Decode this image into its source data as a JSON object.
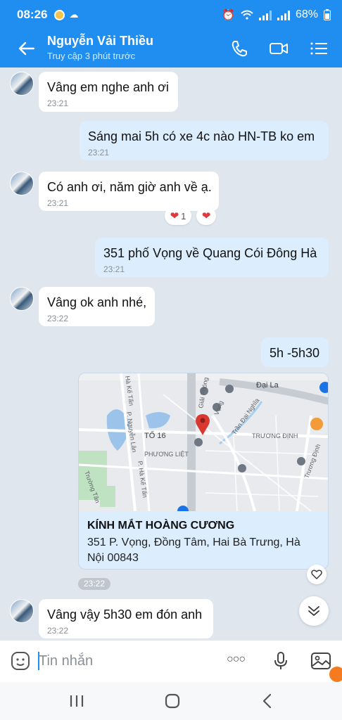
{
  "status_bar": {
    "time": "08:26",
    "battery": "68%"
  },
  "header": {
    "contact_name": "Nguyễn Vải Thiều",
    "last_seen": "Truy cập 3 phút trước",
    "icons": [
      "back-arrow-icon",
      "phone-icon",
      "video-call-icon",
      "menu-list-icon"
    ]
  },
  "messages": [
    {
      "direction": "in",
      "text": "Vâng em nghe anh ơi",
      "time": "23:21"
    },
    {
      "direction": "out",
      "text": "Sáng mai 5h có xe 4c nào HN-TB ko em",
      "time": "23:21"
    },
    {
      "direction": "in",
      "text": "Có anh ơi, năm giờ anh về ạ.",
      "time": "23:21",
      "reaction_count": "1"
    },
    {
      "direction": "out",
      "text": "351 phố Vọng về Quang Cói Đông Hà",
      "time": "23:21"
    },
    {
      "direction": "in",
      "text": "Vâng ok anh nhé,",
      "time": "23:22"
    },
    {
      "direction": "out",
      "text": "5h -5h30"
    },
    {
      "direction": "in",
      "text": "Vâng vậy 5h30 em đón anh",
      "time": "23:22"
    }
  ],
  "location_card": {
    "place_name": "KÍNH MẮT HOÀNG CƯƠNG",
    "address": "351 P. Vọng, Đồng Tâm, Hai Bà Trưng, Hà Nội 00843",
    "map_labels": {
      "dai_la": "Đại La",
      "to_16": "TỔ 16",
      "phuong_liet": "PHƯƠNG LIỆT",
      "truong_dinh_area": "TRƯƠNG ĐỊNH",
      "truong_dinh_street": "Trương Định",
      "giai_phong": "Giải Phóng",
      "vong": "Vọng",
      "tran_dai_nghia": "Trần Đại Nghĩa",
      "ha_ke_tan": "Hà Kế Tấn",
      "p_nguyen_lan": "P. Nguyễn Lân",
      "p_ha_ke_tan": "P. Hà Kế Tấn",
      "truong_tan": "Trường Tân"
    },
    "time": "23:22"
  },
  "composer": {
    "placeholder": "Tin nhắn",
    "more_dots": "○○○"
  },
  "colors": {
    "brand_blue": "#1f8ef0",
    "outgoing_bubble": "#dcedfd",
    "chat_bg": "#dfe6ee",
    "heart_red": "#e0383e"
  }
}
